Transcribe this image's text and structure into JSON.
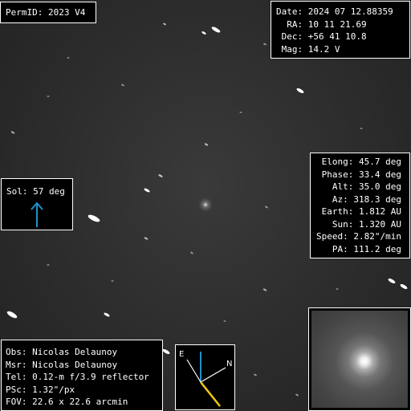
{
  "perm": {
    "text": "PermID: 2023 V4"
  },
  "header": {
    "lines": [
      "Date: 2024 07 12.88359",
      "  RA: 10 11 21.69",
      " Dec: +56 41 10.8",
      " Mag: 14.2 V"
    ]
  },
  "geometry": {
    "lines": [
      "Elong: 45.7 deg",
      "Phase: 33.4 deg",
      "Alt: 35.0 deg",
      "Az: 318.3 deg",
      "Earth: 1.812 AU",
      "Sun: 1.320 AU",
      "Speed: 2.82\"/min",
      "PA: 111.2 deg"
    ]
  },
  "sol": {
    "text": "Sol: 57 deg",
    "arrow_color": "#1e90c8"
  },
  "observer": {
    "lines": [
      "Obs: Nicolas Delaunoy",
      "Msr: Nicolas Delaunoy",
      "Tel: 0.12-m f/3.9 reflector",
      "PSc: 1.32\"/px",
      "FOV: 22.6 x 22.6 arcmin"
    ]
  },
  "compass": {
    "east_label": "E",
    "north_label": "N",
    "east_color": "#1e90c8",
    "motion_color": "#f0c814"
  }
}
